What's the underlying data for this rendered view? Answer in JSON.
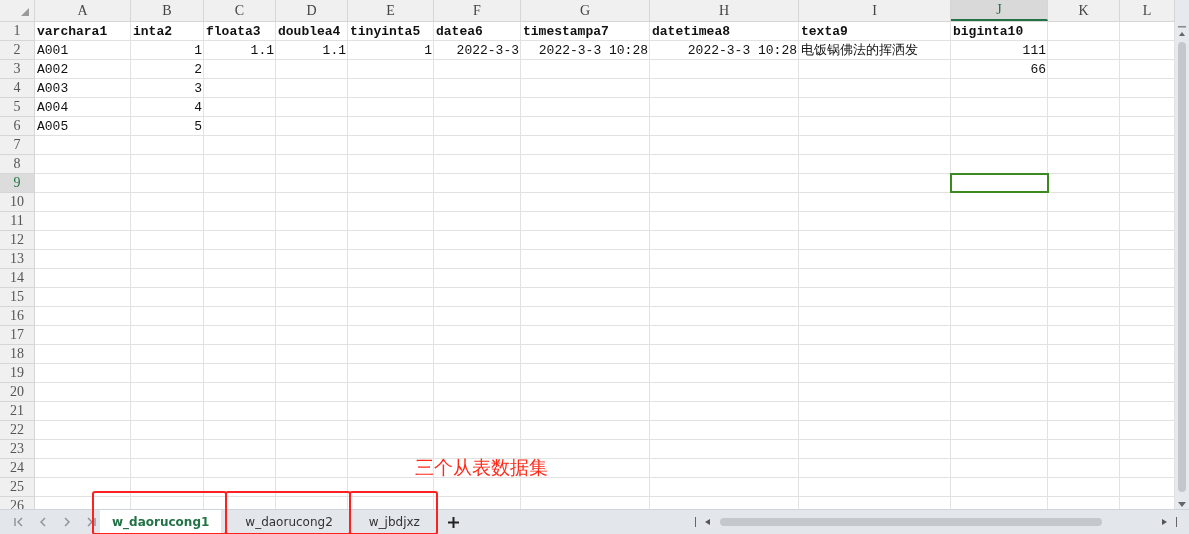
{
  "columns": [
    {
      "label": "A",
      "selected": false
    },
    {
      "label": "B",
      "selected": false
    },
    {
      "label": "C",
      "selected": false
    },
    {
      "label": "D",
      "selected": false
    },
    {
      "label": "E",
      "selected": false
    },
    {
      "label": "F",
      "selected": false
    },
    {
      "label": "G",
      "selected": false
    },
    {
      "label": "H",
      "selected": false
    },
    {
      "label": "I",
      "selected": false
    },
    {
      "label": "J",
      "selected": true
    },
    {
      "label": "K",
      "selected": false
    },
    {
      "label": "L",
      "selected": false
    }
  ],
  "rows": [
    {
      "number": "1",
      "selected": false,
      "cells": [
        {
          "kind": "header",
          "value": "varchara1"
        },
        {
          "kind": "header",
          "value": "inta2"
        },
        {
          "kind": "header",
          "value": "floata3"
        },
        {
          "kind": "header",
          "value": "doublea4"
        },
        {
          "kind": "header",
          "value": "tinyinta5"
        },
        {
          "kind": "header",
          "value": "datea6"
        },
        {
          "kind": "header",
          "value": "timestampa7"
        },
        {
          "kind": "header",
          "value": "datetimea8"
        },
        {
          "kind": "header",
          "value": "texta9"
        },
        {
          "kind": "header",
          "value": "biginta10"
        }
      ]
    },
    {
      "number": "2",
      "selected": false,
      "cells": [
        {
          "kind": "text",
          "value": "A001"
        },
        {
          "kind": "number",
          "value": "1"
        },
        {
          "kind": "number",
          "value": "1.1"
        },
        {
          "kind": "number",
          "value": "1.1"
        },
        {
          "kind": "number",
          "value": "1"
        },
        {
          "kind": "number",
          "value": "2022-3-3"
        },
        {
          "kind": "number",
          "value": "2022-3-3 10:28"
        },
        {
          "kind": "number",
          "value": "2022-3-3 10:28"
        },
        {
          "kind": "text",
          "value": "电饭锅佛法的挥洒发"
        },
        {
          "kind": "number",
          "value": "111"
        }
      ]
    },
    {
      "number": "3",
      "selected": false,
      "cells": [
        {
          "kind": "text",
          "value": "A002"
        },
        {
          "kind": "number",
          "value": "2"
        },
        null,
        null,
        null,
        null,
        null,
        null,
        null,
        {
          "kind": "number",
          "value": "66"
        }
      ]
    },
    {
      "number": "4",
      "selected": false,
      "cells": [
        {
          "kind": "text",
          "value": "A003"
        },
        {
          "kind": "number",
          "value": "3"
        }
      ]
    },
    {
      "number": "5",
      "selected": false,
      "cells": [
        {
          "kind": "text",
          "value": "A004"
        },
        {
          "kind": "number",
          "value": "4"
        }
      ]
    },
    {
      "number": "6",
      "selected": false,
      "cells": [
        {
          "kind": "text",
          "value": "A005"
        },
        {
          "kind": "number",
          "value": "5"
        }
      ]
    },
    {
      "number": "7",
      "selected": false
    },
    {
      "number": "8",
      "selected": false
    },
    {
      "number": "9",
      "selected": true
    },
    {
      "number": "10",
      "selected": false
    },
    {
      "number": "11",
      "selected": false
    },
    {
      "number": "12",
      "selected": false
    },
    {
      "number": "13",
      "selected": false
    },
    {
      "number": "14",
      "selected": false
    },
    {
      "number": "15",
      "selected": false
    },
    {
      "number": "16",
      "selected": false
    },
    {
      "number": "17",
      "selected": false
    },
    {
      "number": "18",
      "selected": false
    },
    {
      "number": "19",
      "selected": false
    },
    {
      "number": "20",
      "selected": false
    },
    {
      "number": "21",
      "selected": false
    },
    {
      "number": "22",
      "selected": false
    },
    {
      "number": "23",
      "selected": false
    },
    {
      "number": "24",
      "selected": false
    },
    {
      "number": "25",
      "selected": false
    },
    {
      "number": "26",
      "selected": false
    }
  ],
  "annotation": {
    "text": "三个从表数据集"
  },
  "sheet_tabs": [
    {
      "label": "w_daorucong1",
      "selected": true,
      "marked": true
    },
    {
      "label": "w_daorucong2",
      "selected": false,
      "marked": true
    },
    {
      "label": "w_jbdjxz",
      "selected": false,
      "marked": true
    }
  ]
}
